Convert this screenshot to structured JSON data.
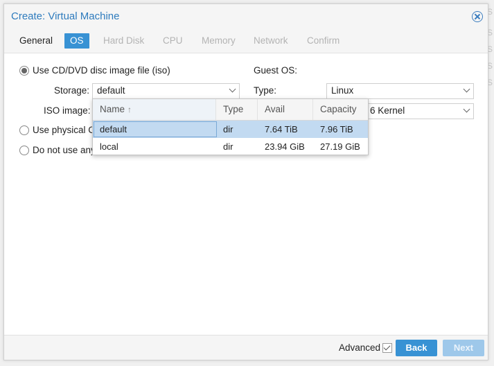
{
  "background_strip": [
    "S",
    "S",
    "S",
    "S",
    "S"
  ],
  "window": {
    "title": "Create: Virtual Machine",
    "tabs": [
      {
        "label": "General",
        "state": "enabled"
      },
      {
        "label": "OS",
        "state": "active"
      },
      {
        "label": "Hard Disk",
        "state": "disabled"
      },
      {
        "label": "CPU",
        "state": "disabled"
      },
      {
        "label": "Memory",
        "state": "disabled"
      },
      {
        "label": "Network",
        "state": "disabled"
      },
      {
        "label": "Confirm",
        "state": "disabled"
      }
    ]
  },
  "os": {
    "radio_iso_label": "Use CD/DVD disc image file (iso)",
    "storage_label": "Storage:",
    "storage_value": "default",
    "iso_label": "ISO image:",
    "radio_physical_label": "Use physical C",
    "radio_none_label": "Do not use any",
    "guest_os_label": "Guest OS:",
    "type_label": "Type:",
    "type_value": "Linux",
    "version_value": "6 Kernel"
  },
  "dropdown": {
    "columns": [
      "Name",
      "Type",
      "Avail",
      "Capacity"
    ],
    "rows": [
      {
        "name": "default",
        "type": "dir",
        "avail": "7.64 TiB",
        "capacity": "7.96 TiB",
        "selected": true
      },
      {
        "name": "local",
        "type": "dir",
        "avail": "23.94 GiB",
        "capacity": "27.19 GiB",
        "selected": false
      }
    ]
  },
  "footer": {
    "advanced_label": "Advanced",
    "advanced_checked": true,
    "back_label": "Back",
    "next_label": "Next"
  },
  "colors": {
    "accent": "#3892d4",
    "title": "#2e7bbd",
    "selected_row": "#c2daf1"
  }
}
